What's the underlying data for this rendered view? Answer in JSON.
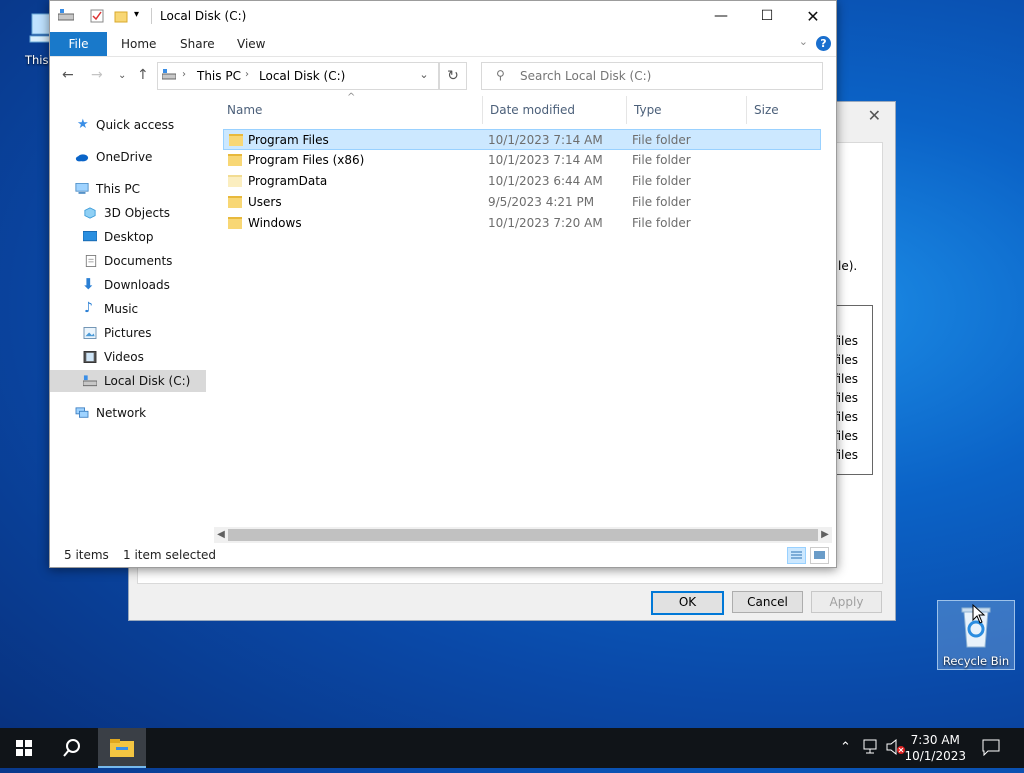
{
  "desktop": {
    "icons": [
      {
        "label": "This PC"
      },
      {
        "label": "Recycle Bin"
      }
    ]
  },
  "background_dialog": {
    "text_fragment": "le).",
    "list_items": [
      "files",
      "files",
      "files",
      "files",
      "files",
      "files",
      "files"
    ],
    "buttons": {
      "ok": "OK",
      "cancel": "Cancel",
      "apply": "Apply"
    }
  },
  "explorer": {
    "title": "Local Disk (C:)",
    "ribbon_tabs": {
      "file": "File",
      "home": "Home",
      "share": "Share",
      "view": "View"
    },
    "help": "?",
    "breadcrumb": [
      "This PC",
      "Local Disk (C:)"
    ],
    "search_placeholder": "Search Local Disk (C:)",
    "nav": {
      "quick_access": "Quick access",
      "onedrive": "OneDrive",
      "this_pc": "This PC",
      "objects3d": "3D Objects",
      "desktop": "Desktop",
      "documents": "Documents",
      "downloads": "Downloads",
      "music": "Music",
      "pictures": "Pictures",
      "videos": "Videos",
      "local_disk": "Local Disk (C:)",
      "network": "Network"
    },
    "columns": {
      "name": "Name",
      "date": "Date modified",
      "type": "Type",
      "size": "Size"
    },
    "rows": [
      {
        "name": "Program Files",
        "date": "10/1/2023 7:14 AM",
        "type": "File folder"
      },
      {
        "name": "Program Files (x86)",
        "date": "10/1/2023 7:14 AM",
        "type": "File folder"
      },
      {
        "name": "ProgramData",
        "date": "10/1/2023 6:44 AM",
        "type": "File folder"
      },
      {
        "name": "Users",
        "date": "9/5/2023 4:21 PM",
        "type": "File folder"
      },
      {
        "name": "Windows",
        "date": "10/1/2023 7:20 AM",
        "type": "File folder"
      }
    ],
    "status": {
      "count": "5 items",
      "selected": "1 item selected"
    }
  },
  "taskbar": {
    "time": "7:30 AM",
    "date": "10/1/2023"
  }
}
